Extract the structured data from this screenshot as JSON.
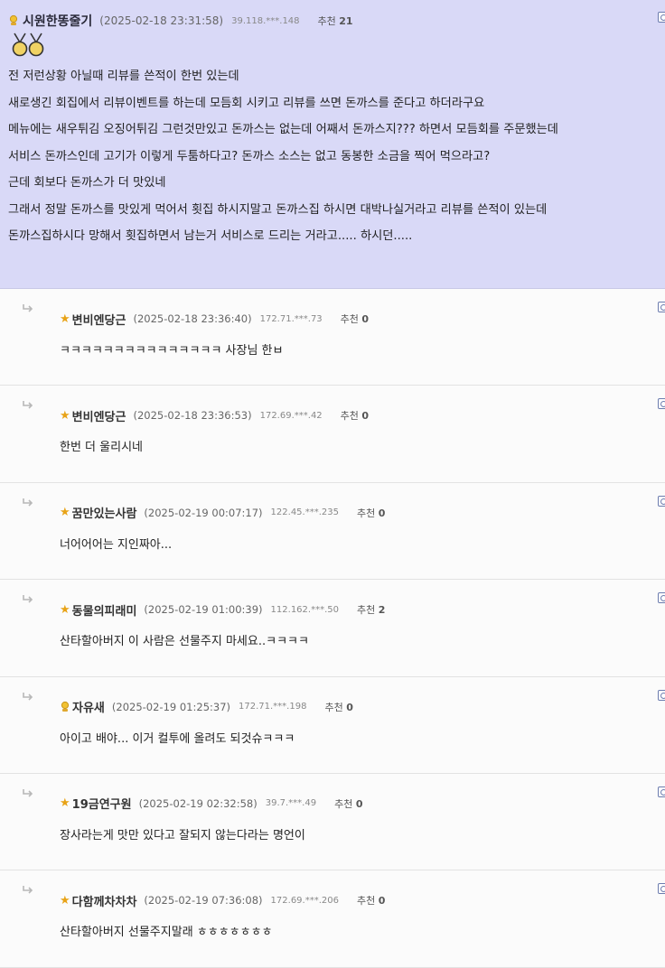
{
  "post": {
    "nickname": "시원한똥줄기",
    "date": "(2025-02-18 23:31:58)",
    "ip": "39.118.***.148",
    "recommend_label": "추천",
    "recommend_count": "21",
    "lines": [
      "전 저런상황 아닐때 리뷰를 쓴적이 한번 있는데",
      "새로생긴 회집에서 리뷰이벤트를 하는데 모듬회 시키고 리뷰를 쓰면 돈까스를 준다고 하더라구요",
      "메뉴에는 새우튀김 오징어튀김 그런것만있고 돈까스는 없는데 어째서 돈까스지??? 하면서 모듬회를 주문했는데",
      "서비스 돈까스인데 고기가 이렇게 두툼하다고? 돈까스 소스는 없고 동봉한 소금을 찍어 먹으라고?",
      "근데 회보다 돈까스가 더 맛있네",
      "그래서 정말 돈까스를 맛있게 먹어서 횟집 하시지말고 돈까스집 하시면 대박나실거라고 리뷰를 쓴적이 있는데",
      "돈까스집하시다 망해서 횟집하면서 남는거 서비스로 드리는 거라고..... 하시던....."
    ]
  },
  "comments": [
    {
      "nickname": "변비엔당근",
      "date": "(2025-02-18 23:36:40)",
      "ip": "172.71.***.73",
      "recommend_label": "추천",
      "recommend_count": "0",
      "text": "ㅋㅋㅋㅋㅋㅋㅋㅋㅋㅋㅋㅋㅋㅋㅋ 사장님 한ㅂ",
      "badge": "star-icon"
    },
    {
      "nickname": "변비엔당근",
      "date": "(2025-02-18 23:36:53)",
      "ip": "172.69.***.42",
      "recommend_label": "추천",
      "recommend_count": "0",
      "text": "한번 더 울리시네",
      "badge": "star-icon"
    },
    {
      "nickname": "꿈만있는사람",
      "date": "(2025-02-19 00:07:17)",
      "ip": "122.45.***.235",
      "recommend_label": "추천",
      "recommend_count": "0",
      "text": "너어어어는 지인짜아...",
      "badge": "star-icon"
    },
    {
      "nickname": "동물의피래미",
      "date": "(2025-02-19 01:00:39)",
      "ip": "112.162.***.50",
      "recommend_label": "추천",
      "recommend_count": "2",
      "text": "산타할아버지 이 사람은 선물주지 마세요..ㅋㅋㅋㅋ",
      "badge": "star-icon"
    },
    {
      "nickname": "자유새",
      "date": "(2025-02-19 01:25:37)",
      "ip": "172.71.***.198",
      "recommend_label": "추천",
      "recommend_count": "0",
      "text": "아이고 배야... 이거 컬투에 올려도 되것슈ㅋㅋㅋ",
      "badge": "member-icon"
    },
    {
      "nickname": "19금연구원",
      "date": "(2025-02-19 02:32:58)",
      "ip": "39.7.***.49",
      "recommend_label": "추천",
      "recommend_count": "0",
      "text": "장사라는게 맛만 있다고 잘되지 않는다라는 명언이",
      "badge": "star-icon"
    },
    {
      "nickname": "다함께차차차",
      "date": "(2025-02-19 07:36:08)",
      "ip": "172.69.***.206",
      "recommend_label": "추천",
      "recommend_count": "0",
      "text": "산타할아버지 선물주지말래 ㅎㅎㅎㅎㅎㅎㅎ",
      "badge": "star-icon"
    }
  ],
  "colors": {
    "post_bg": "#d9d9f7",
    "star": "#e8a317",
    "control_border": "#6c7cae"
  }
}
